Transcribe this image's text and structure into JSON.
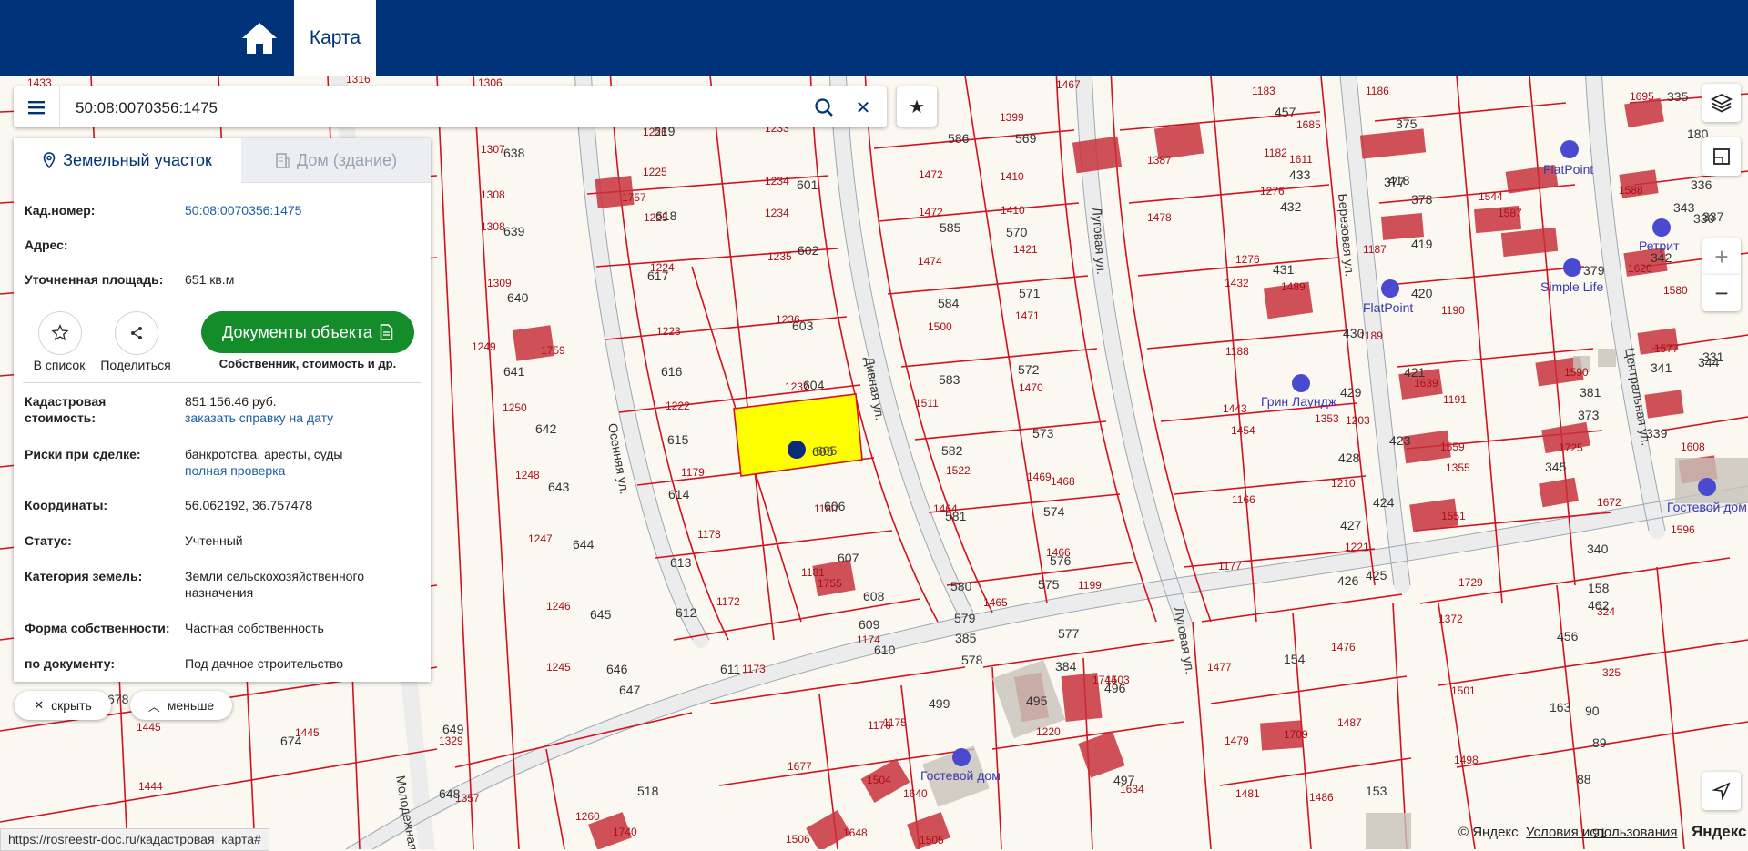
{
  "header": {
    "home_icon": "home-icon",
    "tab_label": "Карта"
  },
  "search": {
    "value": "50:08:0070356:1475",
    "placeholder": ""
  },
  "panel": {
    "tab_land": "Земельный участок",
    "tab_building": "Дом (здание)",
    "cad_label": "Кад.номер:",
    "cad_value": "50:08:0070356:1475",
    "address_label": "Адрес:",
    "area_label": "Уточненная площадь:",
    "area_value": "651 кв.м",
    "to_list": "В список",
    "share": "Поделиться",
    "docs_button": "Документы объекта",
    "docs_sub": "Собственник, стоимость и др.",
    "cost_label": "Кадастровая стоимость:",
    "cost_value": "851 156.46 руб.",
    "cost_link": "заказать справку на дату",
    "risk_label": "Риски при сделке:",
    "risk_value": "банкротства, аресты, суды",
    "risk_link": "полная проверка",
    "coord_label": "Координаты:",
    "coord_value": "56.062192, 36.757478",
    "status_label": "Статус:",
    "status_value": "Учтенный",
    "category_label": "Категория земель:",
    "category_value": "Земли сельскохозяйственного назначения",
    "ownership_label": "Форма собственности:",
    "ownership_value": "Частная собственность",
    "doc_label": "по документу:",
    "doc_value": "Под дачное строительство"
  },
  "pills": {
    "hide": "скрыть",
    "less": "меньше"
  },
  "map": {
    "streets": [
      "Осенняя ул.",
      "Дивная ул.",
      "Луговая ул.",
      "Луговая ул.",
      "Березовая ул.",
      "Центральная ул.",
      "Молодежная"
    ],
    "pois": [
      "FlatPoint",
      "Ретрит",
      "Simple Life",
      "FlatPoint",
      "Грин Лаундж",
      "Гостевой дом",
      "Гостевой дом"
    ],
    "parcel_labels_red": [
      "1433",
      "1316",
      "1306",
      "1307",
      "1308",
      "1308",
      "1309",
      "1249",
      "1759",
      "1250",
      "1248",
      "1247",
      "1246",
      "1245",
      "1329",
      "1357",
      "1445",
      "1445",
      "1444",
      "1226",
      "1233",
      "1757",
      "1225",
      "1225",
      "1234",
      "1234",
      "1235",
      "1224",
      "1236",
      "1223",
      "1237",
      "1222",
      "1179",
      "1180",
      "1178",
      "1181",
      "1755",
      "1172",
      "1174",
      "1173",
      "1176",
      "1175",
      "1177",
      "1210",
      "1221",
      "1166",
      "1203",
      "1260",
      "1740",
      "1506",
      "1648",
      "1505",
      "1504",
      "1640",
      "1677",
      "1220",
      "1503",
      "1744",
      "1634",
      "1481",
      "1486",
      "1479",
      "1709",
      "1487",
      "1477",
      "1476",
      "1372",
      "1501",
      "1498",
      "1729",
      "1596",
      "324",
      "325",
      "1620",
      "1580",
      "1577",
      "1608",
      "1672",
      "1725",
      "1590",
      "1551",
      "1559",
      "1639",
      "1191",
      "1190",
      "1189",
      "1187",
      "1685",
      "1611",
      "1544",
      "1587",
      "1588",
      "1695",
      "1399",
      "1467",
      "1183",
      "1186",
      "1472",
      "1410",
      "1387",
      "1182",
      "1472",
      "1410",
      "1474",
      "1421",
      "1276",
      "1478",
      "1276",
      "1489",
      "1500",
      "1471",
      "1432",
      "1188",
      "1511",
      "1470",
      "1443",
      "1522",
      "1469",
      "1454",
      "1468",
      "1464",
      "1466",
      "1465",
      "1199",
      "1353",
      "1355"
    ],
    "parcel_labels_gray": [
      "619",
      "601",
      "618",
      "602",
      "617",
      "603",
      "616",
      "604",
      "615",
      "605",
      "614",
      "606",
      "613",
      "607",
      "612",
      "608",
      "609",
      "610",
      "611",
      "638",
      "639",
      "640",
      "641",
      "642",
      "643",
      "644",
      "645",
      "646",
      "647",
      "649",
      "648",
      "674",
      "678",
      "518",
      "499",
      "495",
      "496",
      "497",
      "153",
      "154",
      "163",
      "90",
      "89",
      "88",
      "91",
      "158",
      "462",
      "456",
      "457",
      "433",
      "418",
      "432",
      "419",
      "431",
      "420",
      "430",
      "421",
      "429",
      "423",
      "428",
      "424",
      "427",
      "425",
      "426",
      "586",
      "569",
      "585",
      "570",
      "584",
      "571",
      "583",
      "572",
      "582",
      "573",
      "581",
      "574",
      "580",
      "575",
      "579",
      "576",
      "578",
      "577",
      "385",
      "384",
      "375",
      "377",
      "378",
      "379",
      "381",
      "373",
      "345",
      "335",
      "180",
      "336",
      "337",
      "330",
      "331",
      "344",
      "343",
      "342",
      "341",
      "339",
      "340"
    ],
    "selected_parcel": "605"
  },
  "map_controls": {
    "layers_icon": "layers-icon",
    "ruler_icon": "ruler-icon",
    "zoom_in": "+",
    "zoom_out": "−",
    "locate_icon": "navigate-icon"
  },
  "status_url": "https://rosreestr-doc.ru/кадастровая_карта#",
  "attribution": {
    "copyright": "© Яндекс",
    "terms": "Условия использования",
    "logo": "Яндекс"
  },
  "colors": {
    "header": "#00337a",
    "parcel_border": "#d3101e",
    "selected_fill": "#ffff00",
    "building": "#c8323c",
    "docs_button": "#148c2a",
    "map_bg": "#fbf8f1",
    "road": "#eeeeee"
  }
}
